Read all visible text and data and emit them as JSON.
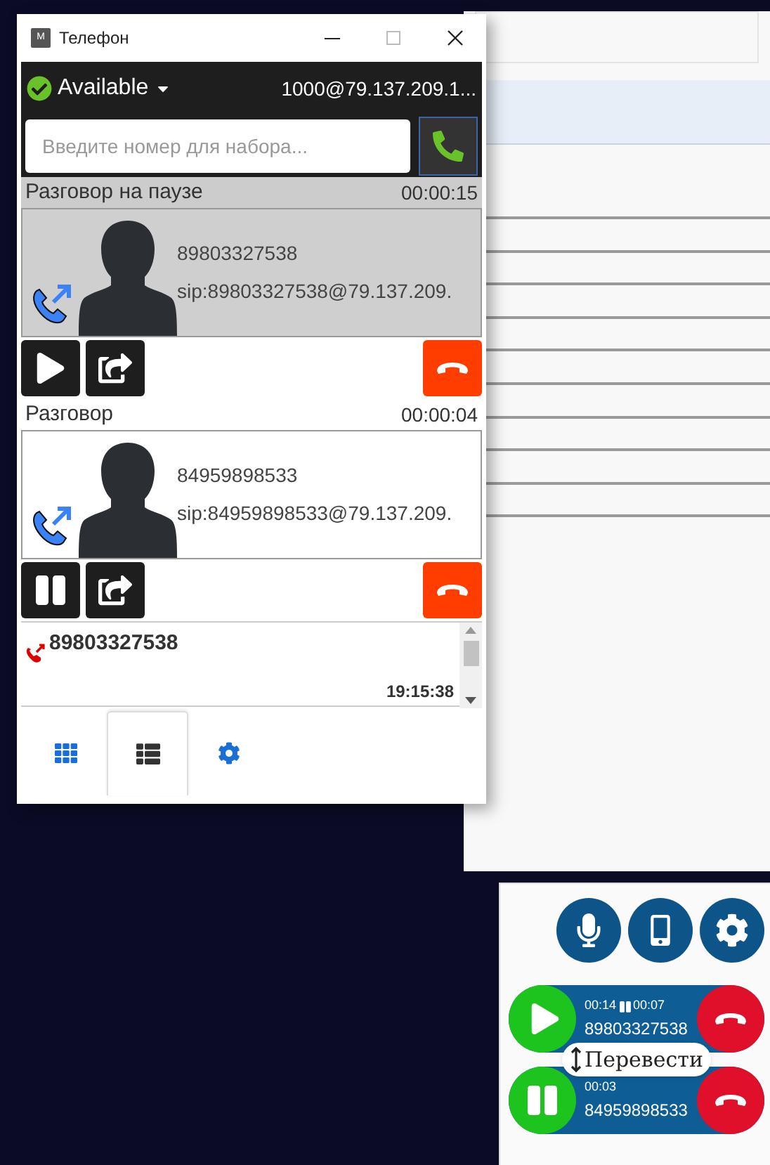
{
  "phone_window": {
    "title": "Телефон",
    "app_icon_letter": "M",
    "status": {
      "label": "Available"
    },
    "account": "1000@79.137.209.1...",
    "dial": {
      "placeholder": "Введите номер для набора..."
    },
    "calls": [
      {
        "kind": "paused",
        "header": "Разговор на паузе",
        "duration": "00:00:15",
        "number": "89803327538",
        "uri": "sip:89803327538@79.137.209."
      },
      {
        "kind": "active",
        "header": "Разговор",
        "duration": "00:00:04",
        "number": "84959898533",
        "uri": "sip:84959898533@79.137.209."
      }
    ],
    "history": [
      {
        "number": "89803327538",
        "time": "19:15:38"
      }
    ],
    "tabs": [
      {
        "kind": "dialpad",
        "selected": false
      },
      {
        "kind": "list",
        "selected": true
      },
      {
        "kind": "settings",
        "selected": false
      }
    ]
  },
  "widget": {
    "buttons": [
      {
        "kind": "mic"
      },
      {
        "kind": "phone"
      },
      {
        "kind": "settings"
      }
    ],
    "calls": [
      {
        "kind": "paused",
        "timer": "00:14",
        "hold_timer": "00:07",
        "number": "89803327538"
      },
      {
        "kind": "active",
        "timer": "00:03",
        "number": "84959898533"
      }
    ],
    "tooltip": "Перевести"
  }
}
